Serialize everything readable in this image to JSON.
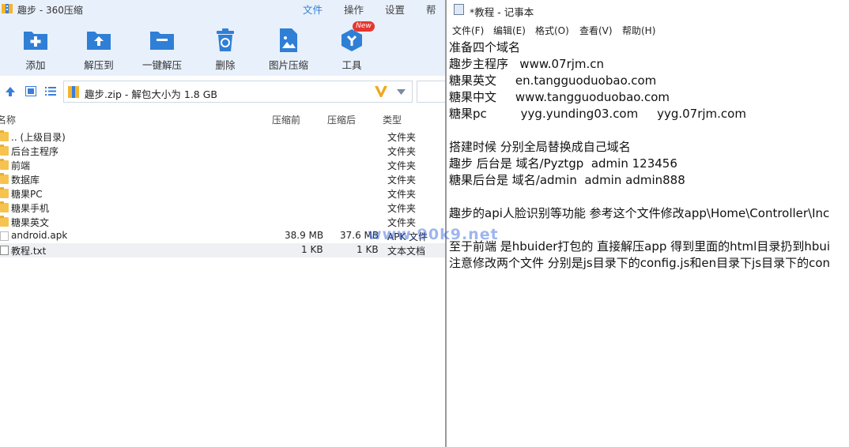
{
  "zip_window": {
    "title": "趣步 - 360压缩",
    "menu": [
      "文件",
      "操作",
      "设置",
      "帮助"
    ],
    "toolbar": [
      {
        "label": "添加",
        "icon": "add-icon"
      },
      {
        "label": "解压到",
        "icon": "extract-to-icon"
      },
      {
        "label": "一键解压",
        "icon": "one-click-extract-icon"
      },
      {
        "label": "删除",
        "icon": "delete-icon"
      },
      {
        "label": "图片压缩",
        "icon": "image-compress-icon"
      },
      {
        "label": "工具",
        "icon": "tools-icon"
      }
    ],
    "new_badge": "New",
    "address": "趣步.zip - 解包大小为 1.8 GB",
    "columns": {
      "name": "名称",
      "before": "压缩前",
      "after": "压缩后",
      "type": "类型"
    },
    "files": [
      {
        "name": ".. (上级目录)",
        "before": "",
        "after": "",
        "type": "文件夹",
        "kind": "folder"
      },
      {
        "name": "后台主程序",
        "before": "",
        "after": "",
        "type": "文件夹",
        "kind": "folder"
      },
      {
        "name": "前端",
        "before": "",
        "after": "",
        "type": "文件夹",
        "kind": "folder"
      },
      {
        "name": "数据库",
        "before": "",
        "after": "",
        "type": "文件夹",
        "kind": "folder"
      },
      {
        "name": "糖果PC",
        "before": "",
        "after": "",
        "type": "文件夹",
        "kind": "folder"
      },
      {
        "name": "糖果手机",
        "before": "",
        "after": "",
        "type": "文件夹",
        "kind": "folder"
      },
      {
        "name": "糖果英文",
        "before": "",
        "after": "",
        "type": "文件夹",
        "kind": "folder"
      },
      {
        "name": "android.apk",
        "before": "38.9 MB",
        "after": "37.6 MB",
        "type": "APK 文件",
        "kind": "apk"
      },
      {
        "name": "教程.txt",
        "before": "1 KB",
        "after": "1 KB",
        "type": "文本文档",
        "kind": "txt"
      }
    ],
    "watermark": "www.90k9.net",
    "colors": {
      "accent": "#2f7fd6",
      "toolbar_bg": "#e8f0fb",
      "folder": "#f6c350"
    }
  },
  "notepad": {
    "title": "*教程 - 记事本",
    "menu": [
      "文件(F)",
      "编辑(E)",
      "格式(O)",
      "查看(V)",
      "帮助(H)"
    ],
    "lines": [
      "准备四个域名",
      "趣步主程序   www.07rjm.cn",
      "糖果英文     en.tangguoduobao.com",
      "糖果中文     www.tangguoduobao.com",
      "糖果pc         yyg.yunding03.com     yyg.07rjm.com",
      "",
      "搭建时候 分别全局替换成自己域名",
      "趣步 后台是 域名/Pyztgp  admin 123456",
      "糖果后台是 域名/admin  admin admin888",
      "",
      "趣步的api人脸识别等功能 参考这个文件修改app\\Home\\Controller\\Inc",
      "",
      "至于前端 是hbuider打包的 直接解压app 得到里面的html目录扔到hbui",
      "注意修改两个文件 分别是js目录下的config.js和en目录下js目录下的con"
    ]
  }
}
